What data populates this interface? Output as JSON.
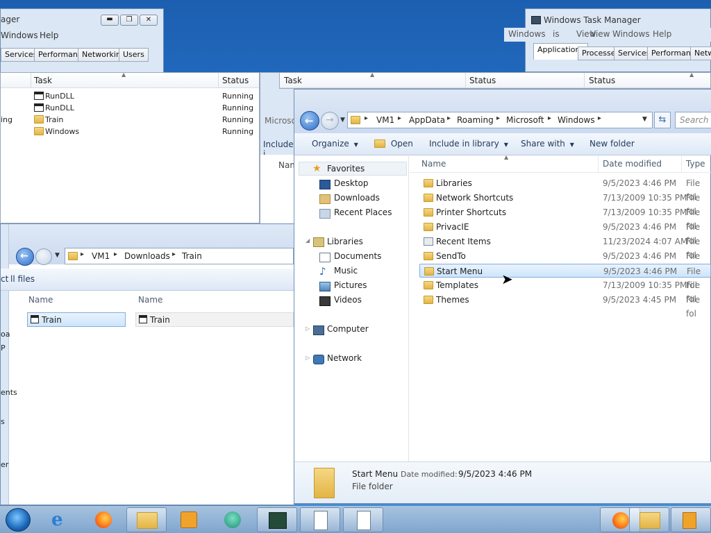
{
  "task_manager_left": {
    "title_fragment": "ager",
    "menu": {
      "windows": "Windows",
      "help": "Help"
    },
    "tabs": [
      "Services",
      "Performance",
      "Networking",
      "Users"
    ],
    "columns": {
      "task": "Task",
      "status": "Status"
    },
    "rows": [
      {
        "name": "RunDLL",
        "status": "Running",
        "icon": "window-icon"
      },
      {
        "name": "RunDLL",
        "status": "Running",
        "icon": "window-icon"
      },
      {
        "name": "Train",
        "status": "Running",
        "icon": "folder-icon",
        "left_fragment": "ing"
      },
      {
        "name": "Windows",
        "status": "Running",
        "icon": "folder-icon"
      }
    ]
  },
  "task_manager_right": {
    "title": "Windows Task Manager",
    "menu": [
      "Windows",
      "dows",
      "is",
      "View",
      "Windows",
      "Help"
    ],
    "tabs": [
      "Applications",
      "Processes",
      "Services",
      "Performance",
      "Netw"
    ],
    "columns": {
      "status": "Status"
    }
  },
  "middle_window": {
    "columns": {
      "task": "Task",
      "status": "Status"
    },
    "fragments": {
      "microsoft": "Microso",
      "include": "Include i",
      "name": "Nam"
    }
  },
  "explorer_downloads": {
    "breadcrumb": [
      "VM1",
      "Downloads",
      "Train"
    ],
    "command_fragment": "ll files",
    "command_prefix": "ct",
    "columns": [
      "Name",
      "Name"
    ],
    "items": [
      "Train",
      "Train"
    ],
    "nav_fragments": [
      "oa",
      "P",
      "ents",
      "s",
      "er"
    ]
  },
  "explorer_main": {
    "breadcrumb": [
      "VM1",
      "AppData",
      "Roaming",
      "Microsoft",
      "Windows"
    ],
    "search_placeholder": "Search W",
    "commands": {
      "organize": "Organize",
      "open": "Open",
      "include": "Include in library",
      "share": "Share with",
      "new_folder": "New folder"
    },
    "columns": {
      "name": "Name",
      "date": "Date modified",
      "type": "Type"
    },
    "nav": {
      "favorites": "Favorites",
      "favorites_items": [
        "Desktop",
        "Downloads",
        "Recent Places"
      ],
      "libraries": "Libraries",
      "libraries_items": [
        "Documents",
        "Music",
        "Pictures",
        "Videos"
      ],
      "computer": "Computer",
      "network": "Network"
    },
    "files": [
      {
        "name": "Libraries",
        "date": "9/5/2023 4:46 PM",
        "type": "File fol",
        "icon": "folder-icon"
      },
      {
        "name": "Network Shortcuts",
        "date": "7/13/2009 10:35 PM",
        "type": "File fol",
        "icon": "folder-icon"
      },
      {
        "name": "Printer Shortcuts",
        "date": "7/13/2009 10:35 PM",
        "type": "File fol",
        "icon": "folder-icon"
      },
      {
        "name": "PrivacIE",
        "date": "9/5/2023 4:46 PM",
        "type": "File fol",
        "icon": "folder-icon"
      },
      {
        "name": "Recent Items",
        "date": "11/23/2024 4:07 AM",
        "type": "File fol",
        "icon": "recent-items-icon"
      },
      {
        "name": "SendTo",
        "date": "9/5/2023 4:46 PM",
        "type": "File fol",
        "icon": "folder-icon"
      },
      {
        "name": "Start Menu",
        "date": "9/5/2023 4:46 PM",
        "type": "File fol",
        "icon": "folder-icon",
        "selected": true
      },
      {
        "name": "Templates",
        "date": "7/13/2009 10:35 PM",
        "type": "File fol",
        "icon": "folder-icon"
      },
      {
        "name": "Themes",
        "date": "9/5/2023 4:45 PM",
        "type": "File fol",
        "icon": "folder-icon"
      }
    ],
    "details": {
      "name": "Start Menu",
      "date_label": "Date modified:",
      "date_value": "9/5/2023 4:46 PM",
      "type": "File folder"
    }
  },
  "taskbar": {
    "items": [
      "start-orb-icon",
      "internet-explorer-icon",
      "firefox-icon",
      "explorer-icon",
      "media-player-icon",
      "chat-icon",
      "task-manager-icon",
      "document-icon",
      "document-icon",
      "firefox-icon",
      "explorer-icon",
      "media-icon"
    ]
  },
  "colors": {
    "selection": "#cde5fb",
    "accent": "#1e395b",
    "folder": "#e3b445"
  }
}
